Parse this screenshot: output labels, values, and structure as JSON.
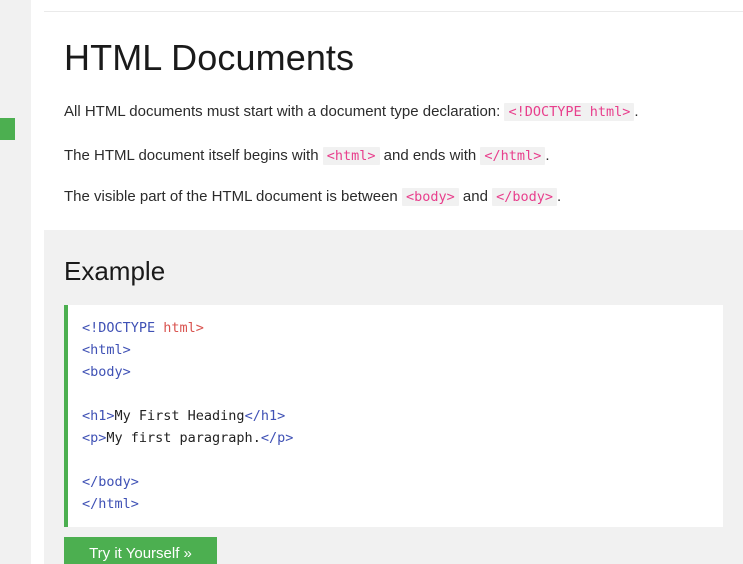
{
  "page": {
    "title": "HTML Documents"
  },
  "paragraphs": [
    {
      "pre": "All HTML documents must start with a document type declaration: ",
      "code": "<!DOCTYPE html>",
      "mid": "",
      "code2": "",
      "post": "."
    },
    {
      "pre": "The HTML document itself begins with ",
      "code": "<html>",
      "mid": " and ends with ",
      "code2": "</html>",
      "post": "."
    },
    {
      "pre": "The visible part of the HTML document is between ",
      "code": "<body>",
      "mid": " and ",
      "code2": "</body>",
      "post": "."
    }
  ],
  "example": {
    "heading": "Example",
    "code_lines": [
      {
        "tag_open": "<!DOCTYPE ",
        "word": "html>",
        "text": ""
      },
      {
        "tag_open": "<html>",
        "word": "",
        "text": ""
      },
      {
        "tag_open": "<body>",
        "word": "",
        "text": ""
      },
      {
        "tag_open": "",
        "word": "",
        "text": ""
      },
      {
        "tag_open": "<h1>",
        "text": "My First Heading",
        "tag_close": "</h1>"
      },
      {
        "tag_open": "<p>",
        "text": "My first paragraph.",
        "tag_close": "</p>"
      },
      {
        "tag_open": "",
        "word": "",
        "text": ""
      },
      {
        "tag_open": "</body>",
        "word": "",
        "text": ""
      },
      {
        "tag_open": "</html>",
        "word": "",
        "text": ""
      }
    ],
    "try_button_label": "Try it Yourself »"
  },
  "colors": {
    "accent_green": "#4caf50",
    "panel_gray": "#f1f1f1",
    "inline_code_pink": "#e83e8c",
    "tag_blue": "#3f51b5",
    "doctype_red": "#d9534f",
    "scrollbar_thumb": "#c2c2c2"
  },
  "scrollbar": {
    "up_arrow_icon": "triangle-up-icon",
    "marker_icon": "scroll-position-marker"
  }
}
